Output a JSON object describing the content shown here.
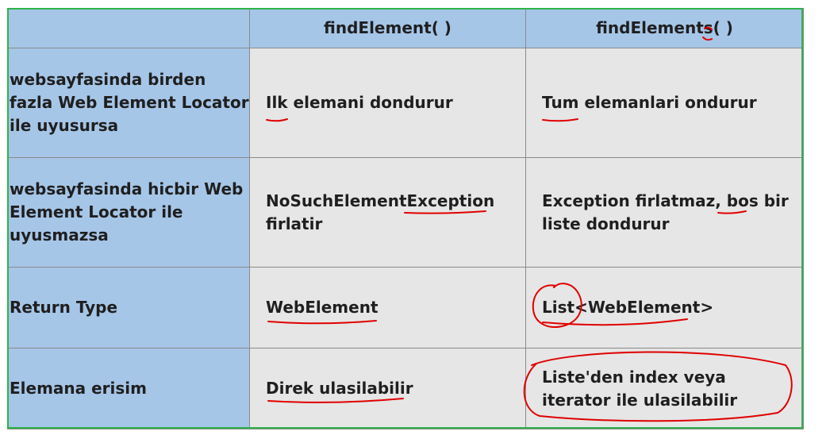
{
  "header": {
    "empty": "",
    "col1": "findElement( )",
    "col2": "findElements( )"
  },
  "rows": [
    {
      "label": "websayfasinda birden fazla Web Element Locator ile uyusursa",
      "find_element": "Ilk elemani dondurur",
      "find_elements": "Tum elemanlari ondurur"
    },
    {
      "label": "websayfasinda hicbir Web Element Locator ile uyusmazsa",
      "find_element": "NoSuchElementException firlatir",
      "find_elements": "Exception firlatmaz, bos bir liste dondurur"
    },
    {
      "label": "Return Type",
      "find_element": "WebElement",
      "find_elements": "List<WebElement>"
    },
    {
      "label": "Elemana erisim",
      "find_element": "Direk ulasilabilir",
      "find_elements": "Liste'den index veya iterator ile ulasilabilir"
    }
  ],
  "colors": {
    "header_bg": "#a6c6e8",
    "cell_bg": "#e6e6e6",
    "frame": "#2db34a",
    "annotation": "#e00000"
  }
}
